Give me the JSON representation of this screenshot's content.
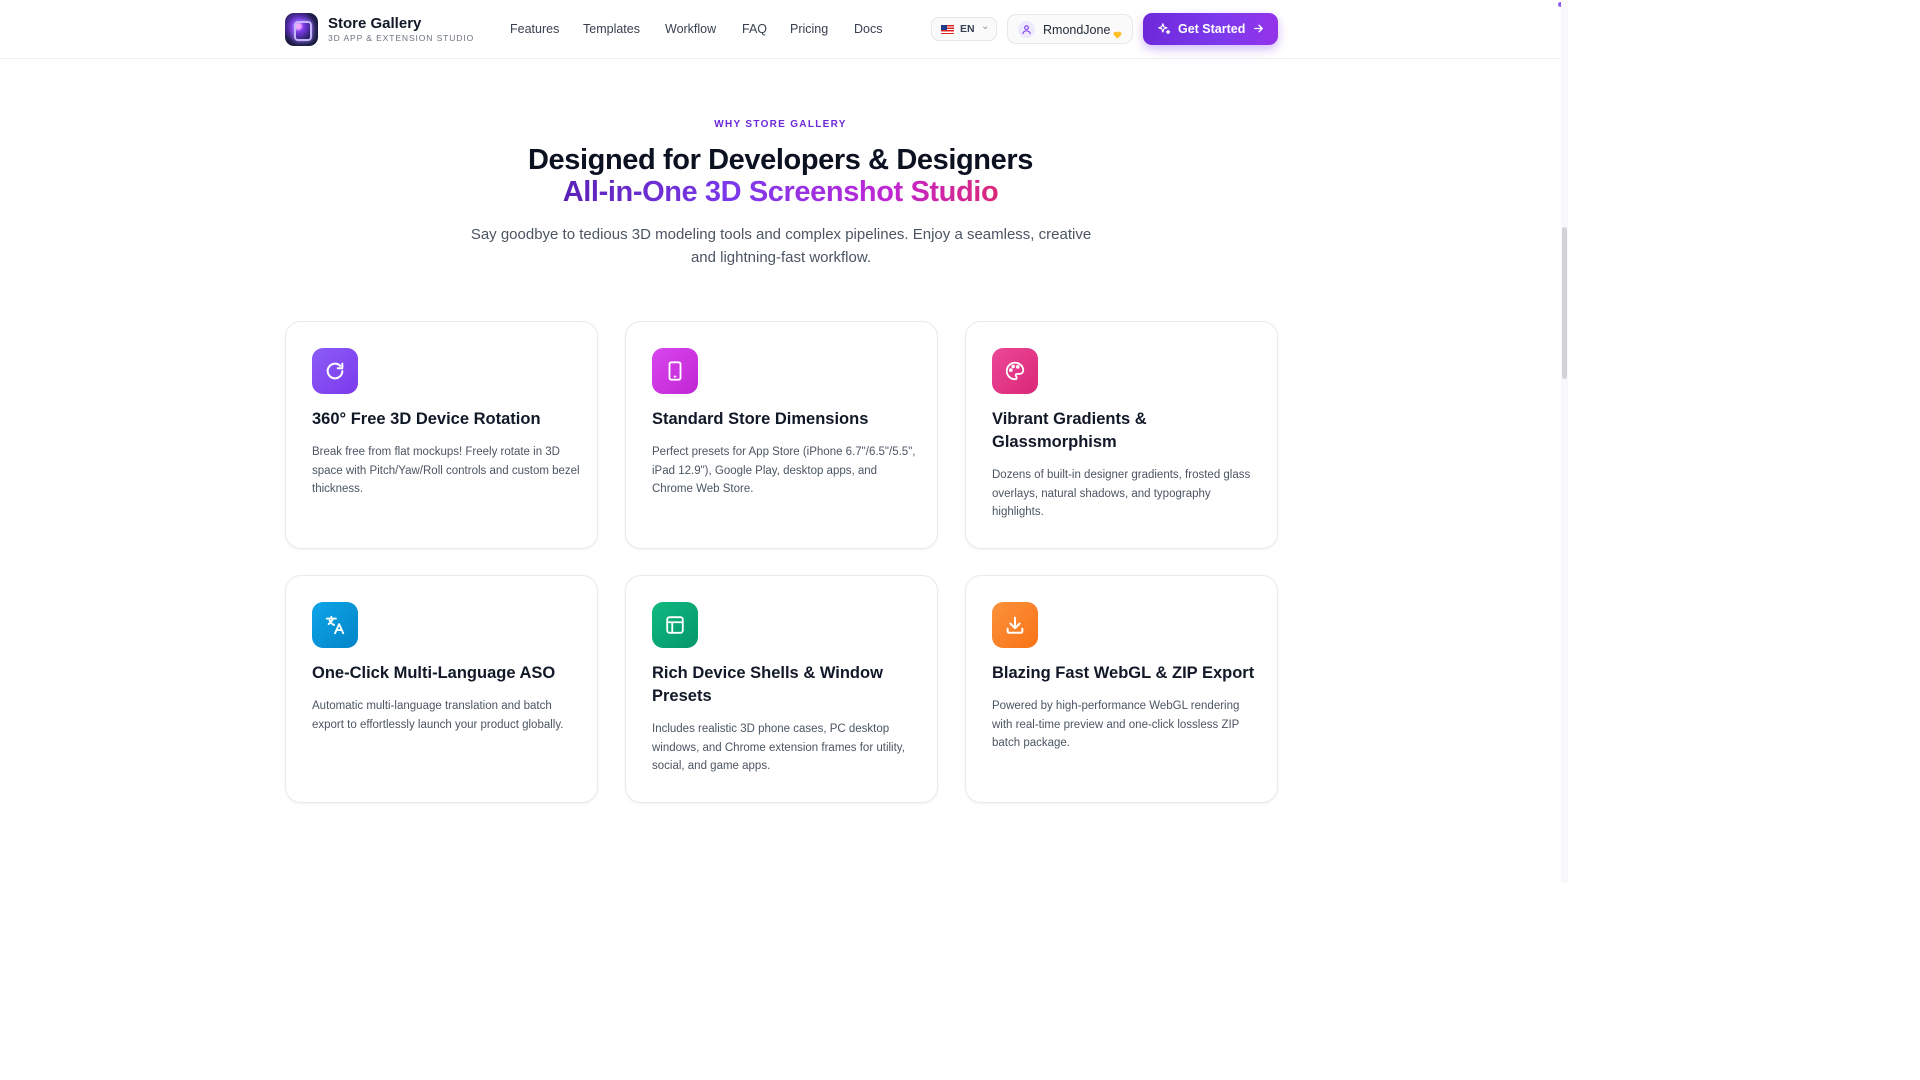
{
  "brand": {
    "name": "Store Gallery",
    "subtitle": "3D APP & EXTENSION STUDIO",
    "logo_icon": "app-logo-icon"
  },
  "nav": {
    "items": [
      {
        "label": "Features"
      },
      {
        "label": "Templates"
      },
      {
        "label": "Workflow"
      },
      {
        "label": "FAQ"
      },
      {
        "label": "Pricing"
      },
      {
        "label": "Docs"
      }
    ]
  },
  "language": {
    "code": "EN",
    "flag_icon": "us-flag-icon"
  },
  "user": {
    "name": "RmondJone",
    "icon": "user-icon",
    "badge_icon": "heart-badge-icon"
  },
  "cta": {
    "label": "Get Started",
    "icon": "sparkles-icon",
    "trailing_icon": "arrow-right-icon"
  },
  "hero": {
    "eyebrow": "WHY STORE GALLERY",
    "title_line1": "Designed for Developers & Designers",
    "title_line2": "All-in-One 3D Screenshot Studio",
    "subtitle": "Say goodbye to tedious 3D modeling tools and complex pipelines. Enjoy a seamless, creative and lightning-fast workflow."
  },
  "features": [
    {
      "title": "360° Free 3D Device Rotation",
      "description": "Break free from flat mockups! Freely rotate in 3D space with Pitch/Yaw/Roll controls and custom bezel thickness.",
      "icon": "rotate-icon",
      "color": "#8b5cf6"
    },
    {
      "title": "Standard Store Dimensions",
      "description": "Perfect presets for App Store (iPhone 6.7\"/6.5\"/5.5\", iPad 12.9\"), Google Play, desktop apps, and Chrome Web Store.",
      "icon": "tablet-icon",
      "color": "#d946ef"
    },
    {
      "title": "Vibrant Gradients & Glassmorphism",
      "description": "Dozens of built-in designer gradients, frosted glass overlays, natural shadows, and typography highlights.",
      "icon": "palette-icon",
      "color": "#ec4899"
    },
    {
      "title": "One-Click Multi-Language ASO",
      "description": "Automatic multi-language translation and batch export to effortlessly launch your product globally.",
      "icon": "translate-icon",
      "color": "#0ea5e9"
    },
    {
      "title": "Rich Device Shells & Window Presets",
      "description": "Includes realistic 3D phone cases, PC desktop windows, and Chrome extension frames for utility, social, and game apps.",
      "icon": "layout-icon",
      "color": "#10b981"
    },
    {
      "title": "Blazing Fast WebGL & ZIP Export",
      "description": "Powered by high-performance WebGL rendering with real-time preview and one-click lossless ZIP batch package.",
      "icon": "download-icon",
      "color": "#f97316"
    }
  ]
}
